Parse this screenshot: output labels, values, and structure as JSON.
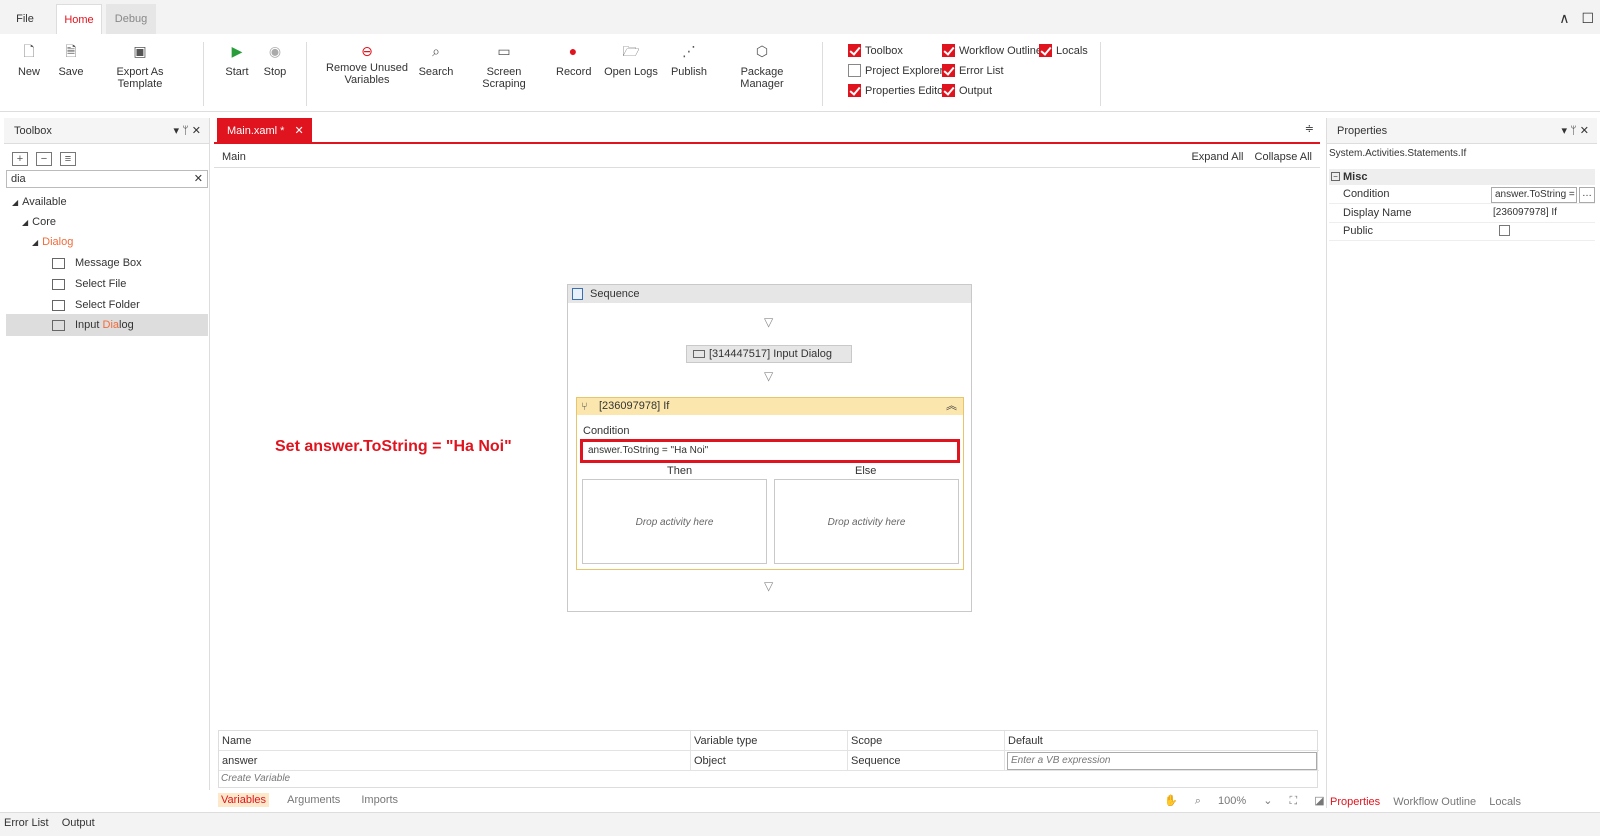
{
  "tabs": {
    "file": "File",
    "home": "Home",
    "debug": "Debug"
  },
  "window": {
    "collapse": "∧",
    "chat": "☐"
  },
  "ribbon": {
    "new": "New",
    "save": "Save",
    "export": "Export As Template",
    "start": "Start",
    "stop": "Stop",
    "remove_unused_line1": "Remove Unused",
    "remove_unused_line2": "Variables",
    "search": "Search",
    "screen_scraping": "Screen Scraping",
    "record": "Record",
    "open_logs": "Open Logs",
    "publish": "Publish",
    "package_manager": "Package Manager",
    "checks": {
      "toolbox": "Toolbox",
      "workflow_outline": "Workflow Outline",
      "locals": "Locals",
      "project_explorer": "Project Explorer",
      "error_list": "Error List",
      "properties_editor": "Properties Editor",
      "output": "Output"
    }
  },
  "toolbox": {
    "title": "Toolbox",
    "search_value": "dia",
    "tree": {
      "available": "Available",
      "core": "Core",
      "dialog_prefix": "",
      "dialog_match": "Dia",
      "dialog_rest": "log",
      "message_box": "Message Box",
      "select_file": "Select File",
      "select_folder": "Select Folder",
      "input_prefix": "Input ",
      "input_match": "Dia",
      "input_rest": "log"
    }
  },
  "designer": {
    "tab": "Main.xaml *",
    "breadcrumb": "Main",
    "expand_all": "Expand All",
    "collapse_all": "Collapse All",
    "annotation": "Set answer.ToString = \"Ha Noi\"",
    "sequence": "Sequence",
    "input_dialog": "[314447517] Input Dialog",
    "if_title": "[236097978] If",
    "condition_label": "Condition",
    "condition_value": "answer.ToString = \"Ha Noi\"",
    "then": "Then",
    "else": "Else",
    "drop_then": "Drop activity here",
    "drop_else": "Drop activity here"
  },
  "variables": {
    "headers": {
      "name": "Name",
      "type": "Variable type",
      "scope": "Scope",
      "default": "Default"
    },
    "row": {
      "name": "answer",
      "type": "Object",
      "scope": "Sequence",
      "default_placeholder": "Enter a VB expression"
    },
    "create": "Create Variable",
    "tabs": {
      "variables": "Variables",
      "arguments": "Arguments",
      "imports": "Imports"
    },
    "zoom": "100%"
  },
  "properties": {
    "title": "Properties",
    "type": "System.Activities.Statements.If",
    "category": "Misc",
    "condition_label": "Condition",
    "condition_value": "answer.ToString = \"Ha Noi\"",
    "display_name_label": "Display Name",
    "display_name_value": "[236097978] If",
    "public_label": "Public",
    "tabs": {
      "properties": "Properties",
      "workflow_outline": "Workflow Outline",
      "locals": "Locals"
    }
  },
  "status": {
    "error_list": "Error List",
    "output": "Output"
  },
  "colors": {
    "accent": "#e0141e",
    "if_header": "#fbe7ad"
  }
}
